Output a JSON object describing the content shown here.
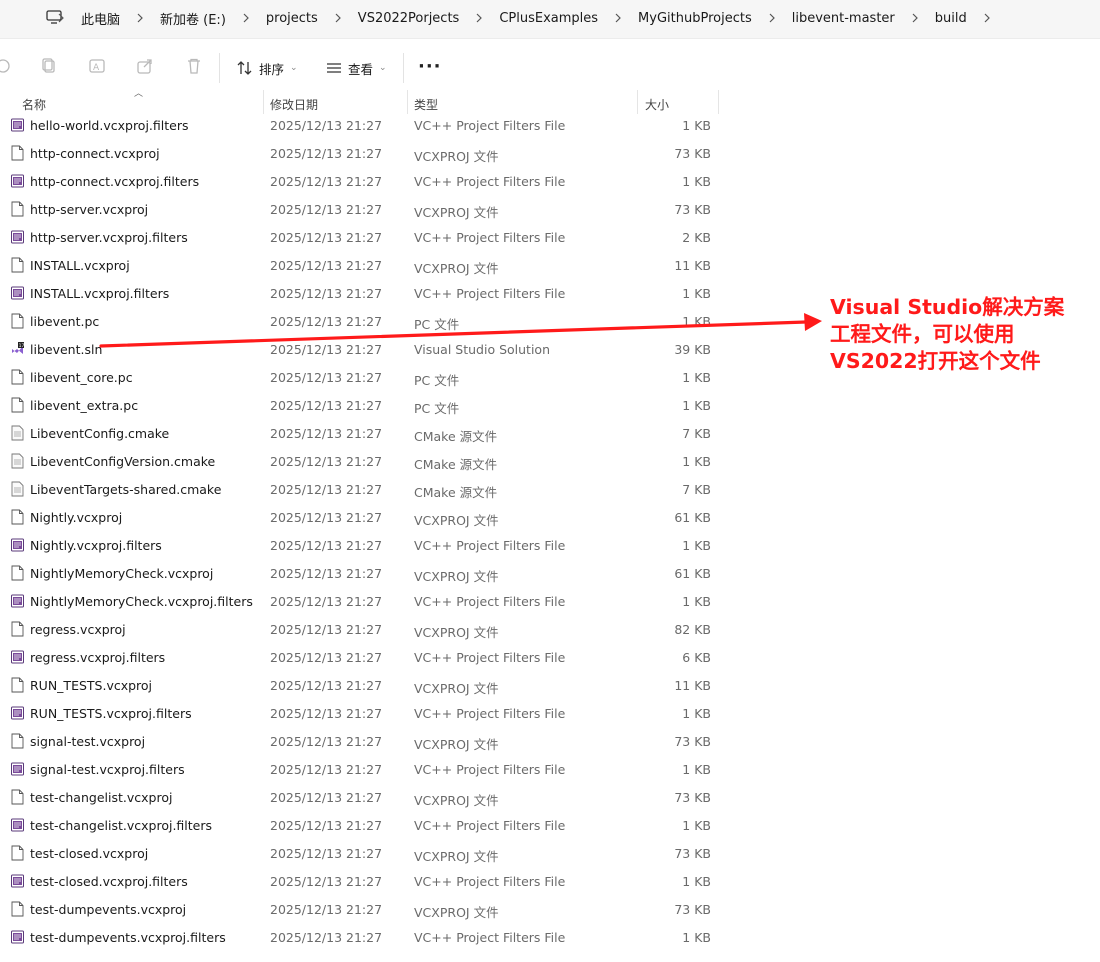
{
  "breadcrumb": [
    "此电脑",
    "新加卷 (E:)",
    "projects",
    "VS2022Porjects",
    "CPlusExamples",
    "MyGithubProjects",
    "libevent-master",
    "build"
  ],
  "toolbar": {
    "sort_label": "排序",
    "view_label": "查看",
    "more_label": "···"
  },
  "columns": {
    "name": "名称",
    "date": "修改日期",
    "type": "类型",
    "size": "大小"
  },
  "files": [
    {
      "name": "hello-world.vcxproj.filters",
      "date": "2025/12/13 21:27",
      "type": "VC++ Project Filters File",
      "size": "1 KB",
      "icon": "filters"
    },
    {
      "name": "http-connect.vcxproj",
      "date": "2025/12/13 21:27",
      "type": "VCXPROJ 文件",
      "size": "73 KB",
      "icon": "file"
    },
    {
      "name": "http-connect.vcxproj.filters",
      "date": "2025/12/13 21:27",
      "type": "VC++ Project Filters File",
      "size": "1 KB",
      "icon": "filters"
    },
    {
      "name": "http-server.vcxproj",
      "date": "2025/12/13 21:27",
      "type": "VCXPROJ 文件",
      "size": "73 KB",
      "icon": "file"
    },
    {
      "name": "http-server.vcxproj.filters",
      "date": "2025/12/13 21:27",
      "type": "VC++ Project Filters File",
      "size": "2 KB",
      "icon": "filters"
    },
    {
      "name": "INSTALL.vcxproj",
      "date": "2025/12/13 21:27",
      "type": "VCXPROJ 文件",
      "size": "11 KB",
      "icon": "file"
    },
    {
      "name": "INSTALL.vcxproj.filters",
      "date": "2025/12/13 21:27",
      "type": "VC++ Project Filters File",
      "size": "1 KB",
      "icon": "filters"
    },
    {
      "name": "libevent.pc",
      "date": "2025/12/13 21:27",
      "type": "PC 文件",
      "size": "1 KB",
      "icon": "file"
    },
    {
      "name": "libevent.sln",
      "date": "2025/12/13 21:27",
      "type": "Visual Studio Solution",
      "size": "39 KB",
      "icon": "sln"
    },
    {
      "name": "libevent_core.pc",
      "date": "2025/12/13 21:27",
      "type": "PC 文件",
      "size": "1 KB",
      "icon": "file"
    },
    {
      "name": "libevent_extra.pc",
      "date": "2025/12/13 21:27",
      "type": "PC 文件",
      "size": "1 KB",
      "icon": "file"
    },
    {
      "name": "LibeventConfig.cmake",
      "date": "2025/12/13 21:27",
      "type": "CMake 源文件",
      "size": "7 KB",
      "icon": "cmake"
    },
    {
      "name": "LibeventConfigVersion.cmake",
      "date": "2025/12/13 21:27",
      "type": "CMake 源文件",
      "size": "1 KB",
      "icon": "cmake"
    },
    {
      "name": "LibeventTargets-shared.cmake",
      "date": "2025/12/13 21:27",
      "type": "CMake 源文件",
      "size": "7 KB",
      "icon": "cmake"
    },
    {
      "name": "Nightly.vcxproj",
      "date": "2025/12/13 21:27",
      "type": "VCXPROJ 文件",
      "size": "61 KB",
      "icon": "file"
    },
    {
      "name": "Nightly.vcxproj.filters",
      "date": "2025/12/13 21:27",
      "type": "VC++ Project Filters File",
      "size": "1 KB",
      "icon": "filters"
    },
    {
      "name": "NightlyMemoryCheck.vcxproj",
      "date": "2025/12/13 21:27",
      "type": "VCXPROJ 文件",
      "size": "61 KB",
      "icon": "file"
    },
    {
      "name": "NightlyMemoryCheck.vcxproj.filters",
      "date": "2025/12/13 21:27",
      "type": "VC++ Project Filters File",
      "size": "1 KB",
      "icon": "filters"
    },
    {
      "name": "regress.vcxproj",
      "date": "2025/12/13 21:27",
      "type": "VCXPROJ 文件",
      "size": "82 KB",
      "icon": "file"
    },
    {
      "name": "regress.vcxproj.filters",
      "date": "2025/12/13 21:27",
      "type": "VC++ Project Filters File",
      "size": "6 KB",
      "icon": "filters"
    },
    {
      "name": "RUN_TESTS.vcxproj",
      "date": "2025/12/13 21:27",
      "type": "VCXPROJ 文件",
      "size": "11 KB",
      "icon": "file"
    },
    {
      "name": "RUN_TESTS.vcxproj.filters",
      "date": "2025/12/13 21:27",
      "type": "VC++ Project Filters File",
      "size": "1 KB",
      "icon": "filters"
    },
    {
      "name": "signal-test.vcxproj",
      "date": "2025/12/13 21:27",
      "type": "VCXPROJ 文件",
      "size": "73 KB",
      "icon": "file"
    },
    {
      "name": "signal-test.vcxproj.filters",
      "date": "2025/12/13 21:27",
      "type": "VC++ Project Filters File",
      "size": "1 KB",
      "icon": "filters"
    },
    {
      "name": "test-changelist.vcxproj",
      "date": "2025/12/13 21:27",
      "type": "VCXPROJ 文件",
      "size": "73 KB",
      "icon": "file"
    },
    {
      "name": "test-changelist.vcxproj.filters",
      "date": "2025/12/13 21:27",
      "type": "VC++ Project Filters File",
      "size": "1 KB",
      "icon": "filters"
    },
    {
      "name": "test-closed.vcxproj",
      "date": "2025/12/13 21:27",
      "type": "VCXPROJ 文件",
      "size": "73 KB",
      "icon": "file"
    },
    {
      "name": "test-closed.vcxproj.filters",
      "date": "2025/12/13 21:27",
      "type": "VC++ Project Filters File",
      "size": "1 KB",
      "icon": "filters"
    },
    {
      "name": "test-dumpevents.vcxproj",
      "date": "2025/12/13 21:27",
      "type": "VCXPROJ 文件",
      "size": "73 KB",
      "icon": "file"
    },
    {
      "name": "test-dumpevents.vcxproj.filters",
      "date": "2025/12/13 21:27",
      "type": "VC++ Project Filters File",
      "size": "1 KB",
      "icon": "filters"
    }
  ],
  "annotation": {
    "text": "Visual Studio解决方案\n工程文件，可以使用\nVS2022打开这个文件",
    "color": "#ff1a1a"
  }
}
